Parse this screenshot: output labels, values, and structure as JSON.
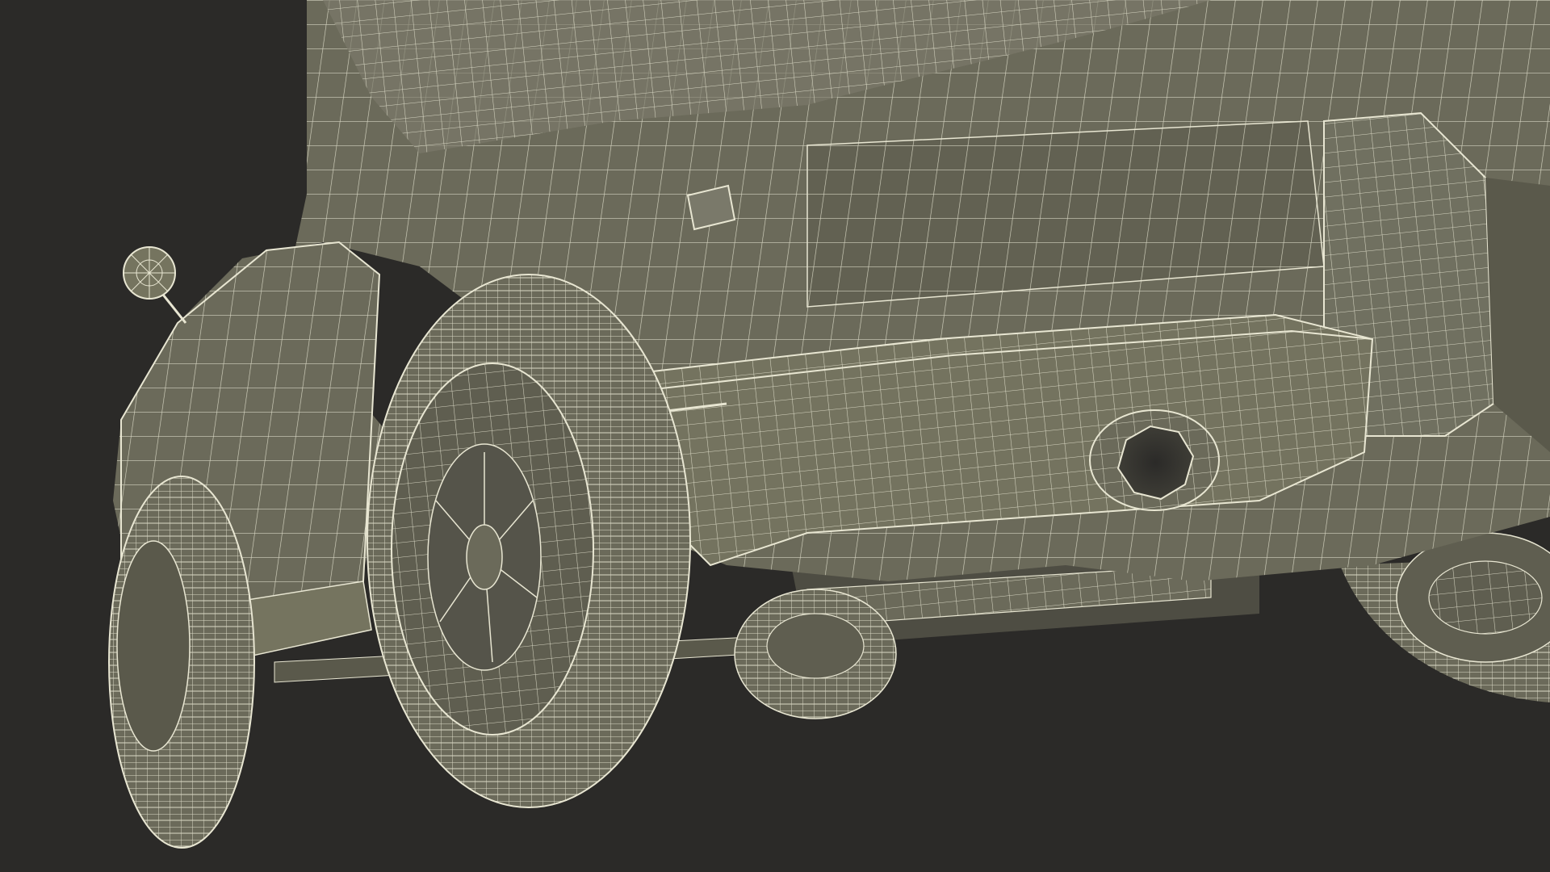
{
  "scene": {
    "subject_icon": "car-wireframe-icon",
    "colors": {
      "background": "#2b2a28",
      "surface": "#6b6a5a",
      "surface_light": "#7a796a",
      "surface_dark": "#5a594b",
      "wire": "#e8e6d2",
      "shadow": "#3a3933"
    }
  }
}
